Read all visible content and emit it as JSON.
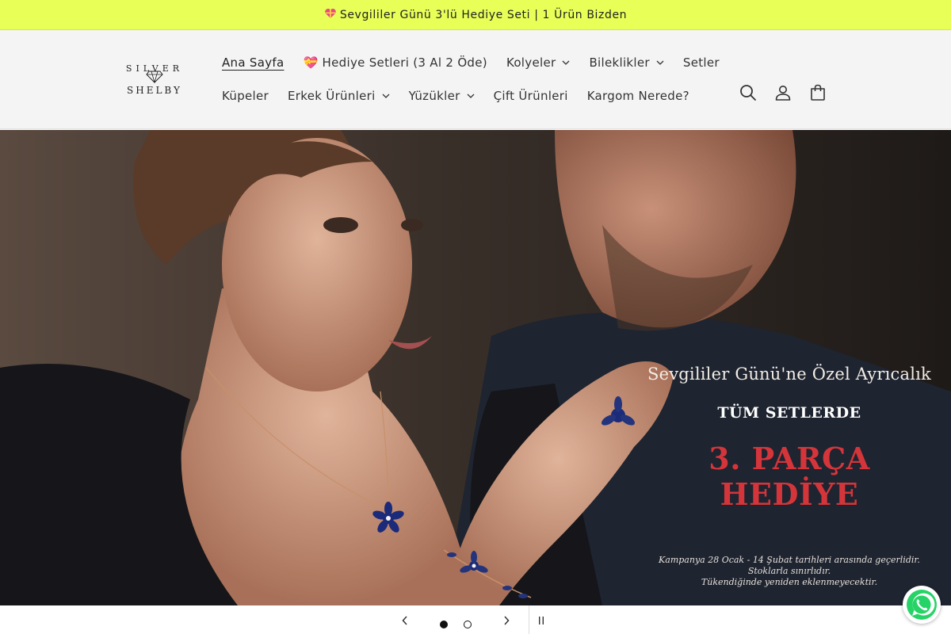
{
  "announcement": {
    "icon": "heart-gift-icon",
    "text": "Sevgililer Günü 3'lü Hediye Seti | 1 Ürün Bizden"
  },
  "logo": {
    "icon": "diamond-logo",
    "text_top": "SILVER",
    "text_bottom": "SHELBY"
  },
  "nav": {
    "row1": [
      {
        "label": "Ana Sayfa",
        "active": true,
        "dropdown": false
      },
      {
        "label": "💝 Hediye Setleri (3 Al 2 Öde)",
        "active": false,
        "dropdown": false
      },
      {
        "label": "Kolyeler",
        "active": false,
        "dropdown": true
      },
      {
        "label": "Bileklikler",
        "active": false,
        "dropdown": true
      },
      {
        "label": "Setler",
        "active": false,
        "dropdown": false
      }
    ],
    "row2": [
      {
        "label": "Küpeler",
        "active": false,
        "dropdown": false
      },
      {
        "label": "Erkek Ürünleri",
        "active": false,
        "dropdown": true
      },
      {
        "label": "Yüzükler",
        "active": false,
        "dropdown": true
      },
      {
        "label": "Çift Ürünleri",
        "active": false,
        "dropdown": false
      },
      {
        "label": "Kargom Nerede?",
        "active": false,
        "dropdown": false
      }
    ]
  },
  "header_icons": [
    "search-icon",
    "account-icon",
    "cart-icon"
  ],
  "hero": {
    "subtitle": "Sevgililer Günü'ne Özel Ayrıcalık",
    "tag": "TÜM SETLERDE",
    "title": "3. PARÇA HEDİYE",
    "note_line1": "Kampanya 28 Ocak - 14 Şubat tarihleri arasında geçerlidir. Stoklarla sınırlıdır.",
    "note_line2": "Tükendiğinde yeniden eklenmeyecektir.",
    "title_color": "#d4353a"
  },
  "slider": {
    "current_slide": 1,
    "total_slides": 2
  },
  "colors": {
    "announcement_bg": "#e8ff57",
    "header_bg": "#f4f4f4",
    "whatsapp": "#25d366"
  }
}
